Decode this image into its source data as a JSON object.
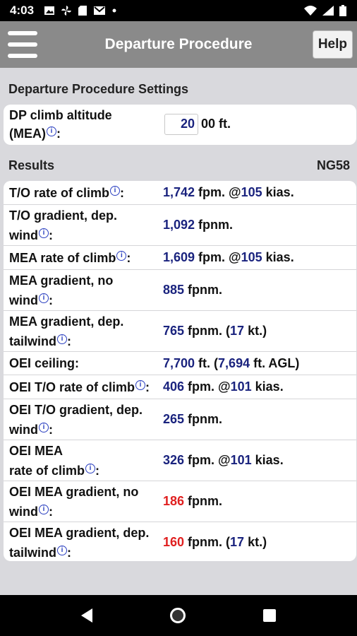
{
  "status_bar": {
    "time": "4:03",
    "icons": [
      "photo-icon",
      "fan-icon",
      "sd-card-icon",
      "mail-icon",
      "dot-icon"
    ],
    "right_icons": [
      "wifi-icon",
      "signal-icon",
      "battery-icon"
    ]
  },
  "app_bar": {
    "title": "Departure Procedure",
    "help_label": "Help"
  },
  "settings": {
    "heading": "Departure Procedure Settings",
    "dp_climb_label_1": "DP climb altitude",
    "dp_climb_label_2": "(MEA)",
    "dp_climb_label_3": ":",
    "altitude_value": "20",
    "altitude_suffix": "00 ft."
  },
  "results": {
    "heading": "Results",
    "aircraft": "NG58",
    "rows": [
      {
        "label_1": "T/O rate of climb",
        "label_2": "",
        "info": true,
        "value_num": "1,742",
        "value_text_1": " fpm. @",
        "value_num2": "105",
        "value_text_2": " kias."
      },
      {
        "label_1": "T/O gradient, dep.",
        "label_2": "wind",
        "info": true,
        "value_num": "1,092",
        "value_text_1": " fpnm.",
        "value_num2": "",
        "value_text_2": ""
      },
      {
        "label_1": "MEA rate of climb",
        "label_2": "",
        "info": true,
        "value_num": "1,609",
        "value_text_1": " fpm. @",
        "value_num2": "105",
        "value_text_2": " kias."
      },
      {
        "label_1": "MEA gradient, no",
        "label_2": "wind",
        "info": true,
        "value_num": "885",
        "value_text_1": " fpnm.",
        "value_num2": "",
        "value_text_2": ""
      },
      {
        "label_1": "MEA gradient, dep.",
        "label_2": "tailwind",
        "info": true,
        "value_num": "765",
        "value_text_1": " fpnm. (",
        "value_num2": "17",
        "value_text_2": " kt.)"
      },
      {
        "label_1": "OEI ceiling:",
        "label_2": "",
        "info": false,
        "value_num": "7,700",
        "value_text_1": " ft. (",
        "value_num2": "7,694",
        "value_text_2": " ft. AGL)"
      },
      {
        "label_1": "OEI T/O rate of climb",
        "label_2": "",
        "info": true,
        "value_num": "406",
        "value_text_1": " fpm. @",
        "value_num2": "101",
        "value_text_2": " kias."
      },
      {
        "label_1": "OEI T/O gradient, dep.",
        "label_2": "wind",
        "info": true,
        "value_num": "265",
        "value_text_1": " fpnm.",
        "value_num2": "",
        "value_text_2": ""
      },
      {
        "label_1": "OEI MEA",
        "label_2": "rate of climb",
        "info": true,
        "value_num": "326",
        "value_text_1": " fpm. @",
        "value_num2": "101",
        "value_text_2": " kias."
      },
      {
        "label_1": "OEI MEA gradient, no",
        "label_2": "wind",
        "info": true,
        "value_num": "186",
        "value_text_1": " fpnm.",
        "value_num2": "",
        "value_text_2": "",
        "warn": true
      },
      {
        "label_1": "OEI MEA gradient, dep.",
        "label_2": "tailwind",
        "info": true,
        "value_num": "160",
        "value_text_1": " fpnm. (",
        "value_num2": "17",
        "value_text_2": " kt.)",
        "warn": true
      }
    ]
  },
  "nav_bar": {
    "icons": [
      "back-icon",
      "home-icon",
      "recents-icon"
    ]
  },
  "colors": {
    "value_blue": "#1a237e",
    "value_red": "#e02020",
    "app_bar": "#8a8a8a",
    "background": "#d9d9dd"
  }
}
